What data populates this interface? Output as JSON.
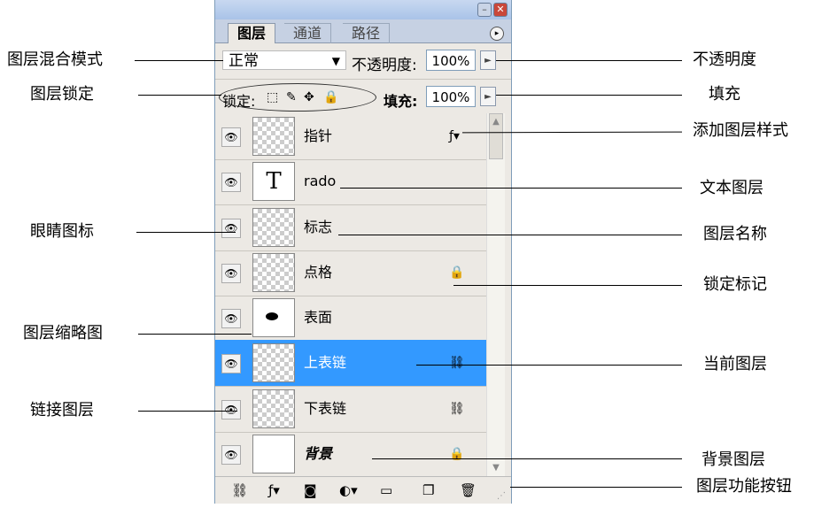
{
  "panel": {
    "tabs": [
      "图层",
      "通道",
      "路径"
    ],
    "blend_mode": "正常",
    "opacity_label": "不透明度:",
    "opacity_value": "100%",
    "lock_label": "锁定:",
    "fill_label": "填充:",
    "fill_value": "100%",
    "layers": [
      {
        "name": "指针",
        "thumb": "checker",
        "icon": "fx-icon",
        "selected": false
      },
      {
        "name": "rado",
        "thumb": "T",
        "icon": "",
        "selected": false
      },
      {
        "name": "标志",
        "thumb": "checker",
        "icon": "",
        "selected": false
      },
      {
        "name": "点格",
        "thumb": "checker",
        "icon": "lock-icon",
        "selected": false
      },
      {
        "name": "表面",
        "thumb": "blob",
        "icon": "",
        "selected": false
      },
      {
        "name": "上表链",
        "thumb": "checker",
        "icon": "link-icon",
        "selected": true
      },
      {
        "name": "下表链",
        "thumb": "checker",
        "icon": "link-icon",
        "selected": false
      },
      {
        "name": "背景",
        "thumb": "white",
        "icon": "lock-icon",
        "selected": false
      }
    ],
    "accent_color": "#3399ff"
  },
  "callouts": {
    "left": [
      "图层混合模式",
      "图层锁定",
      "眼睛图标",
      "图层缩略图",
      "链接图层"
    ],
    "right": [
      "不透明度",
      "填充",
      "添加图层样式",
      "文本图层",
      "图层名称",
      "锁定标记",
      "当前图层",
      "背景图层",
      "图层功能按钮"
    ]
  }
}
